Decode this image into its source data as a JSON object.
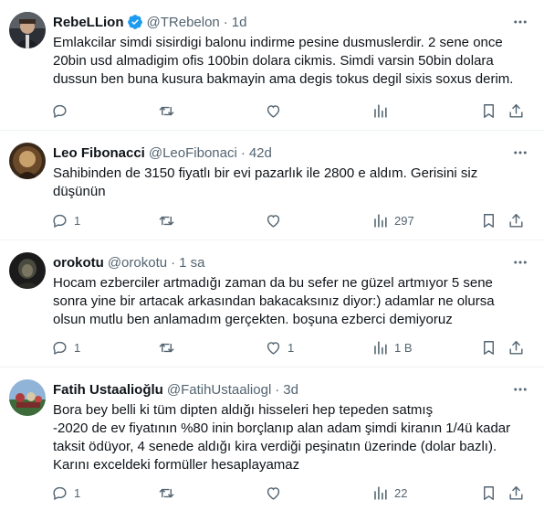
{
  "tweets": [
    {
      "name": "RebeLLion",
      "verified": true,
      "handle": "@TRebelon",
      "dot": "·",
      "time": "1d",
      "lines": [
        "Emlakcilar simdi sisirdigi balonu indirme pesine dusmuslerdir. 2 sene once",
        "20bin usd almadigim ofis 100bin dolara cikmis. Simdi varsin 50bin dolara",
        "dussun ben buna kusura bakmayin ama degis tokus degil sixis soxus derim."
      ],
      "replies": "",
      "retweets": "",
      "likes": "",
      "views": ""
    },
    {
      "name": "Leo Fibonacci",
      "verified": false,
      "handle": "@LeoFibonaci",
      "dot": "·",
      "time": "42d",
      "lines": [
        "Sahibinden de 3150 fiyatlı bir evi pazarlık ile 2800 e aldım. Gerisini siz",
        "düşünün"
      ],
      "replies": "1",
      "retweets": "",
      "likes": "",
      "views": "297"
    },
    {
      "name": "orokotu",
      "verified": false,
      "handle": "@orokotu",
      "dot": "·",
      "time": "1 sa",
      "lines": [
        "Hocam ezberciler artmadığı zaman da bu sefer ne güzel artmıyor 5 sene",
        "sonra yine bir artacak arkasından bakacaksınız diyor:) adamlar ne olursa",
        "olsun mutlu ben anlamadım gerçekten. boşuna ezberci demiyoruz"
      ],
      "replies": "1",
      "retweets": "",
      "likes": "1",
      "views": "1 B"
    },
    {
      "name": "Fatih Ustaalioğlu",
      "verified": false,
      "handle": "@FatihUstaaliogl",
      "dot": "·",
      "time": "3d",
      "lines": [
        "Bora bey belli ki tüm dipten aldığı hisseleri hep tepeden satmış",
        "-2020 de ev fiyatının %80 inin borçlanıp alan adam şimdi kiranın 1/4ü kadar",
        "taksit ödüyor, 4 senede aldığı kira verdiği peşinatın üzerinde (dolar bazlı).",
        "Karını exceldeki formüller hesaplayamaz"
      ],
      "replies": "1",
      "retweets": "",
      "likes": "",
      "views": "22"
    }
  ],
  "icons": {
    "verified": "verified-badge-icon",
    "more": "more-icon",
    "reply": "reply-icon",
    "retweet": "retweet-icon",
    "like": "like-icon",
    "views": "views-icon",
    "bookmark": "bookmark-icon",
    "share": "share-icon"
  },
  "colors": {
    "text": "#0f1419",
    "secondary": "#536471",
    "verified": "#1d9bf0",
    "divider": "#eff3f4"
  }
}
